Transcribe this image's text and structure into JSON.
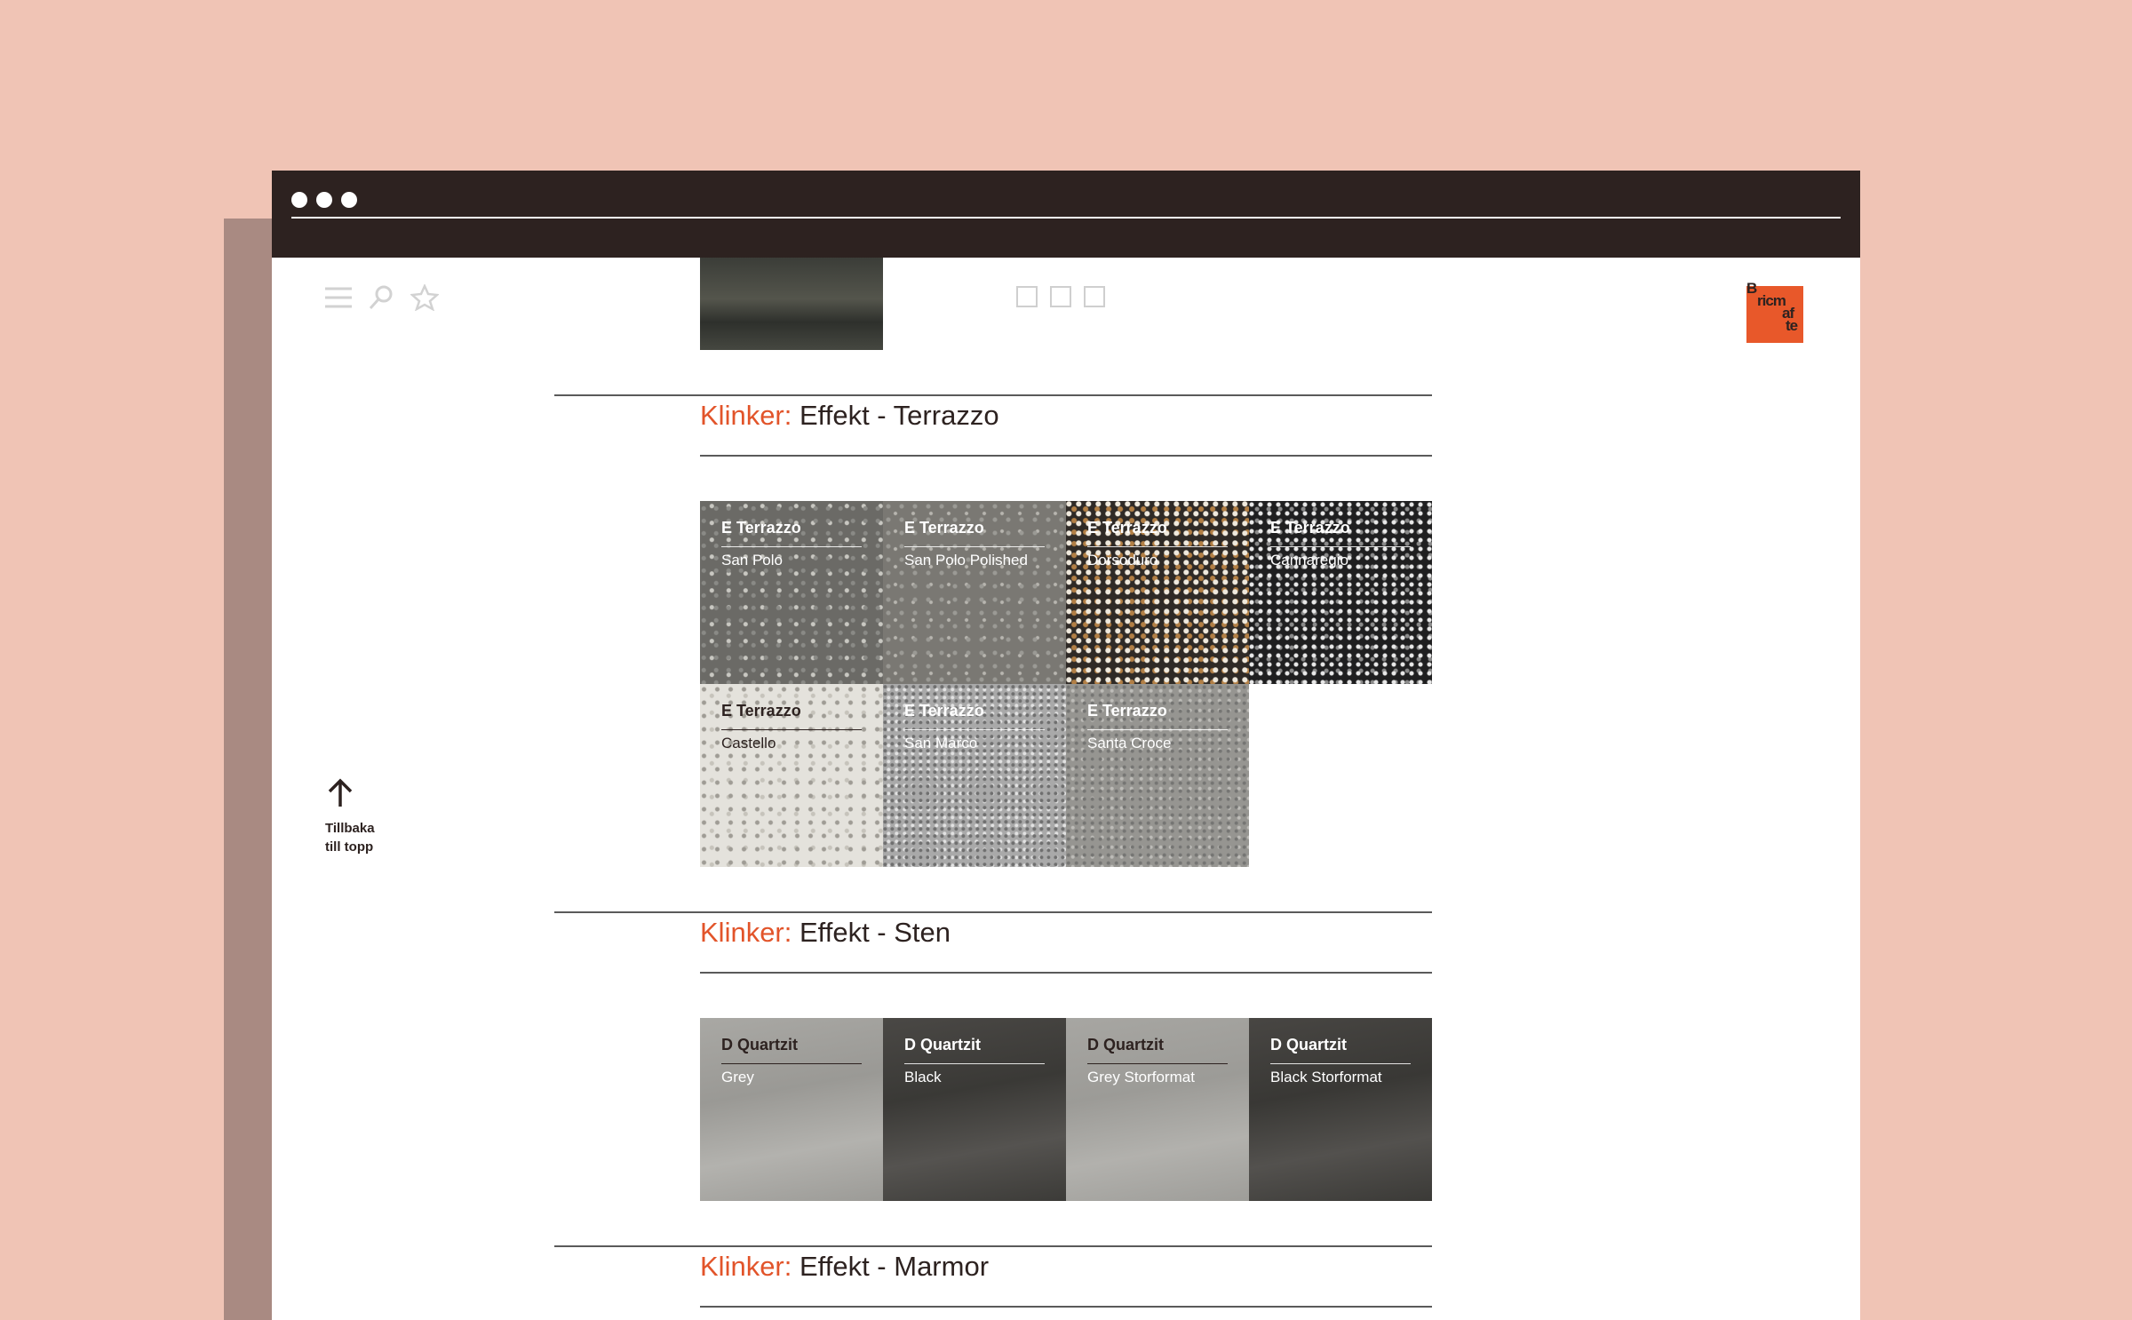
{
  "window": {
    "titlebar_dots": [
      "dot-1",
      "dot-2",
      "dot-3"
    ]
  },
  "toolbar": {
    "icons": [
      "menu-icon",
      "search-icon",
      "star-icon"
    ],
    "tabs_icon": "tabs-icon"
  },
  "logo": {
    "text_lines": [
      "B",
      "ricm",
      "af",
      "te"
    ],
    "color": "#e8582a"
  },
  "back_to_top": {
    "line1": "Tillbaka",
    "line2": "till topp",
    "icon": "arrow-up-icon"
  },
  "sections": [
    {
      "accent": "Klinker:",
      "title": "Effekt - Terrazzo",
      "tiles": [
        {
          "code": "E Terrazzo",
          "name": "San Polo"
        },
        {
          "code": "E Terrazzo",
          "name": "San Polo Polished"
        },
        {
          "code": "E Terrazzo",
          "name": "Dorsoduro"
        },
        {
          "code": "E Terrazzo",
          "name": "Cannaregio"
        },
        {
          "code": "E Terrazzo",
          "name": "Castello"
        },
        {
          "code": "E Terrazzo",
          "name": "San Marco"
        },
        {
          "code": "E Terrazzo",
          "name": "Santa Croce"
        }
      ]
    },
    {
      "accent": "Klinker:",
      "title": "Effekt - Sten",
      "tiles": [
        {
          "code": "D Quartzit",
          "name": "Grey"
        },
        {
          "code": "D Quartzit",
          "name": "Black"
        },
        {
          "code": "D Quartzit",
          "name": "Grey Storformat"
        },
        {
          "code": "D Quartzit",
          "name": "Black Storformat"
        }
      ]
    },
    {
      "accent": "Klinker:",
      "title": "Effekt - Marmor",
      "tiles": []
    }
  ],
  "colors": {
    "background": "#f0c4b5",
    "titlebar": "#2d2220",
    "accent": "#e2542a"
  }
}
